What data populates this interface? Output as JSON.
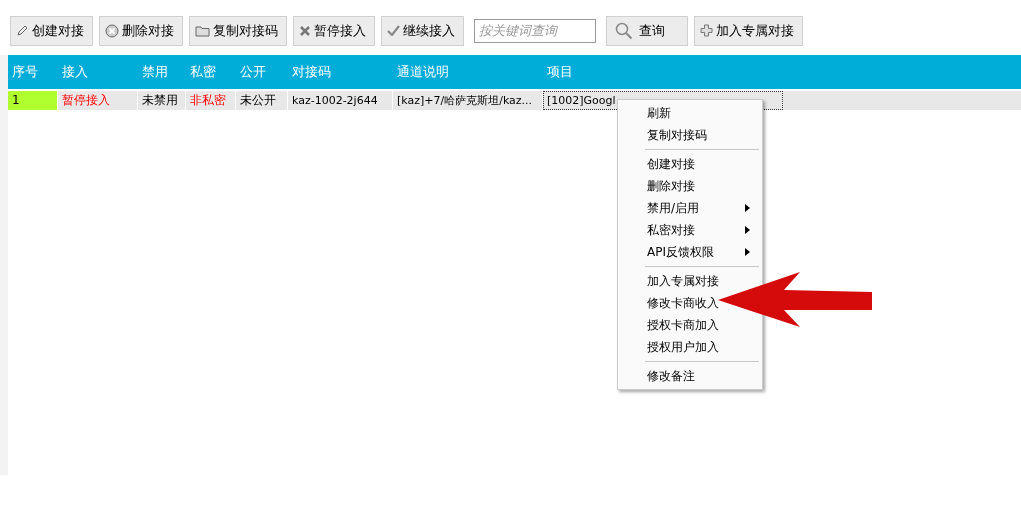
{
  "toolbar": [
    {
      "kind": "button",
      "label": "创建对接"
    },
    {
      "kind": "button",
      "label": "删除对接"
    },
    {
      "kind": "button",
      "label": "复制对接码"
    },
    {
      "kind": "button",
      "label": "暂停接入"
    },
    {
      "kind": "button",
      "label": "继续接入"
    },
    {
      "kind": "search",
      "placeholder": "按关键词查询"
    },
    {
      "kind": "button",
      "label": "查询"
    },
    {
      "kind": "button",
      "label": "加入专属对接"
    }
  ],
  "table": {
    "columns": [
      "序号",
      "接入",
      "禁用",
      "私密",
      "公开",
      "对接码",
      "通道说明",
      "项目"
    ],
    "rows": [
      {
        "selected": true,
        "cells": [
          {
            "kind": "index",
            "text": "1"
          },
          {
            "kind": "alert",
            "text": "暂停接入"
          },
          {
            "kind": "plain",
            "text": "未禁用"
          },
          {
            "kind": "alert",
            "text": "非私密"
          },
          {
            "kind": "plain",
            "text": "未公开"
          },
          {
            "kind": "plain",
            "text": "kaz-1002-2j644"
          },
          {
            "kind": "plain",
            "text": "[kaz]+7/哈萨克斯坦/kaz..."
          },
          {
            "kind": "plain",
            "text": "[1002]Googl",
            "focused": true
          }
        ]
      }
    ]
  },
  "context_menu": {
    "items": [
      {
        "kind": "item",
        "label": "刷新"
      },
      {
        "kind": "item",
        "label": "复制对接码"
      },
      {
        "kind": "separator"
      },
      {
        "kind": "item",
        "label": "创建对接"
      },
      {
        "kind": "item",
        "label": "删除对接"
      },
      {
        "kind": "submenu",
        "label": "禁用/启用"
      },
      {
        "kind": "submenu",
        "label": "私密对接"
      },
      {
        "kind": "submenu",
        "label": "API反馈权限"
      },
      {
        "kind": "separator"
      },
      {
        "kind": "item",
        "label": "加入专属对接"
      },
      {
        "kind": "item",
        "label": "修改卡商收入"
      },
      {
        "kind": "item",
        "label": "授权卡商加入"
      },
      {
        "kind": "item",
        "label": "授权用户加入"
      },
      {
        "kind": "separator"
      },
      {
        "kind": "item",
        "label": "修改备注"
      }
    ]
  }
}
